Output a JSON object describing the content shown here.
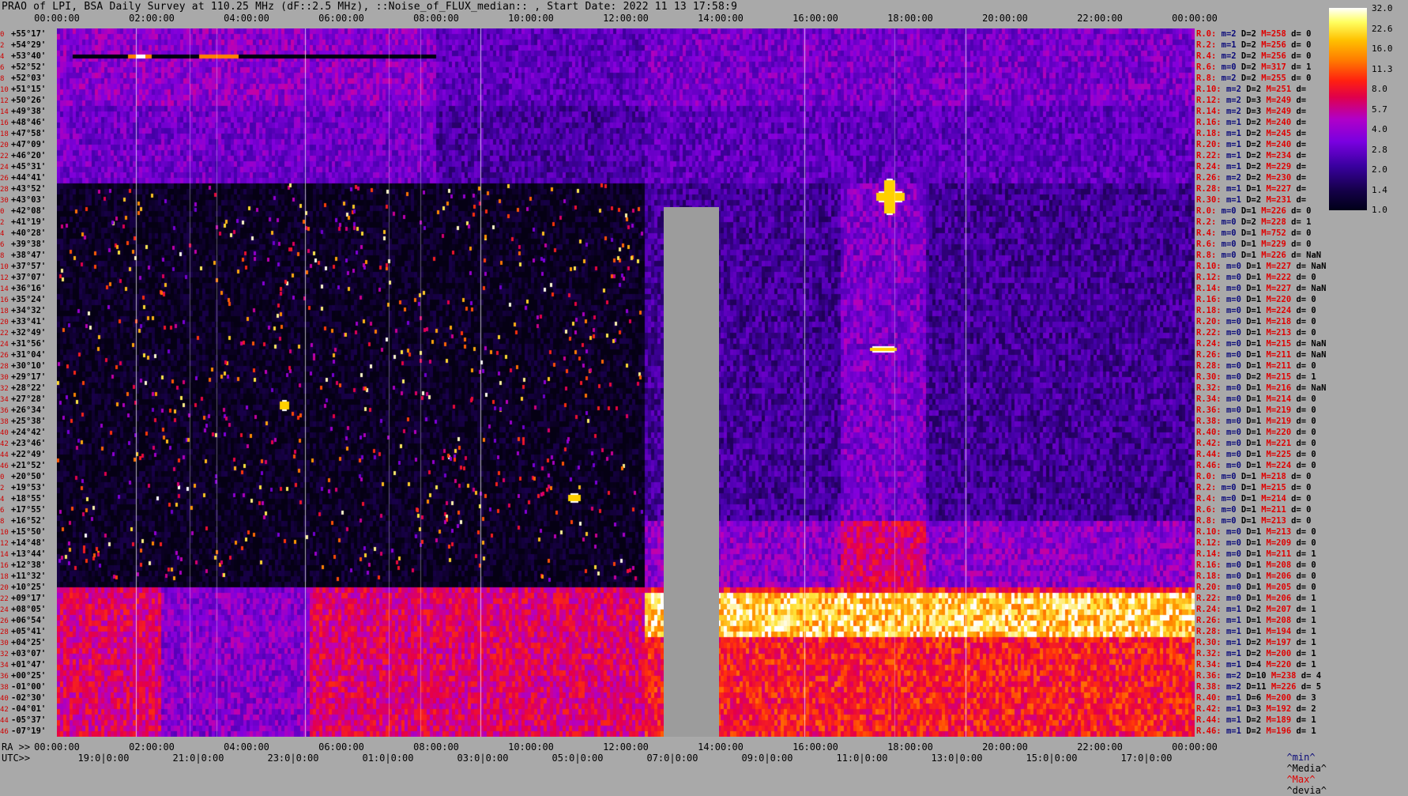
{
  "title": "PRAO of LPI, BSA Daily Survey at 110.25 MHz (dF::2.5 MHz), ::Noise_of_FLUX_median:: , Start Date: 2022 11 13 17:58:9",
  "time_axis_top": [
    "00:00:00",
    "02:00:00",
    "04:00:00",
    "06:00:00",
    "08:00:00",
    "10:00:00",
    "12:00:00",
    "14:00:00",
    "16:00:00",
    "18:00:00",
    "20:00:00",
    "22:00:00",
    "00:00:00"
  ],
  "ra_axis_prefix": "RA >>",
  "ra_axis": [
    "00:00:00",
    "02:00:00",
    "04:00:00",
    "06:00:00",
    "08:00:00",
    "10:00:00",
    "12:00:00",
    "14:00:00",
    "16:00:00",
    "18:00:00",
    "20:00:00",
    "22:00:00",
    "00:00:00"
  ],
  "utc_axis_prefix": "UTC>>",
  "utc_axis": [
    "19:0|0:00",
    "21:0|0:00",
    "23:0|0:00",
    "01:0|0:00",
    "03:0|0:00",
    "05:0|0:00",
    "07:0|0:00",
    "09:0|0:00",
    "11:0|0:00",
    "13:0|0:00",
    "15:0|0:00",
    "17:0|0:00"
  ],
  "colorbar": {
    "labels": [
      "32.0",
      "22.6",
      "16.0",
      "11.3",
      "8.0",
      "5.7",
      "4.0",
      "2.8",
      "2.0",
      "1.4",
      "1.0"
    ],
    "colors": {
      "low": "#000018",
      "mid": "#7a00e0",
      "high": "#ff2010",
      "top": "#ffffff"
    }
  },
  "dec_rows": [
    {
      "idx": "0",
      "dec": "+55°17'"
    },
    {
      "idx": "2",
      "dec": "+54°29'"
    },
    {
      "idx": "4",
      "dec": "+53°40'"
    },
    {
      "idx": "6",
      "dec": "+52°52'"
    },
    {
      "idx": "8",
      "dec": "+52°03'"
    },
    {
      "idx": "10",
      "dec": "+51°15'"
    },
    {
      "idx": "12",
      "dec": "+50°26'"
    },
    {
      "idx": "14",
      "dec": "+49°38'"
    },
    {
      "idx": "16",
      "dec": "+48°46'"
    },
    {
      "idx": "18",
      "dec": "+47°58'"
    },
    {
      "idx": "20",
      "dec": "+47°09'"
    },
    {
      "idx": "22",
      "dec": "+46°20'"
    },
    {
      "idx": "24",
      "dec": "+45°31'"
    },
    {
      "idx": "26",
      "dec": "+44°41'"
    },
    {
      "idx": "28",
      "dec": "+43°52'"
    },
    {
      "idx": "30",
      "dec": "+43°03'"
    },
    {
      "idx": "0",
      "dec": "+42°08'"
    },
    {
      "idx": "2",
      "dec": "+41°19'"
    },
    {
      "idx": "4",
      "dec": "+40°28'"
    },
    {
      "idx": "6",
      "dec": "+39°38'"
    },
    {
      "idx": "8",
      "dec": "+38°47'"
    },
    {
      "idx": "10",
      "dec": "+37°57'"
    },
    {
      "idx": "12",
      "dec": "+37°07'"
    },
    {
      "idx": "14",
      "dec": "+36°16'"
    },
    {
      "idx": "16",
      "dec": "+35°24'"
    },
    {
      "idx": "18",
      "dec": "+34°32'"
    },
    {
      "idx": "20",
      "dec": "+33°41'"
    },
    {
      "idx": "22",
      "dec": "+32°49'"
    },
    {
      "idx": "24",
      "dec": "+31°56'"
    },
    {
      "idx": "26",
      "dec": "+31°04'"
    },
    {
      "idx": "28",
      "dec": "+30°10'"
    },
    {
      "idx": "30",
      "dec": "+29°17'"
    },
    {
      "idx": "32",
      "dec": "+28°22'"
    },
    {
      "idx": "34",
      "dec": "+27°28'"
    },
    {
      "idx": "36",
      "dec": "+26°34'"
    },
    {
      "idx": "38",
      "dec": "+25°38'"
    },
    {
      "idx": "40",
      "dec": "+24°42'"
    },
    {
      "idx": "42",
      "dec": "+23°46'"
    },
    {
      "idx": "44",
      "dec": "+22°49'"
    },
    {
      "idx": "46",
      "dec": "+21°52'"
    },
    {
      "idx": "0",
      "dec": "+20°50'"
    },
    {
      "idx": "2",
      "dec": "+19°53'"
    },
    {
      "idx": "4",
      "dec": "+18°55'"
    },
    {
      "idx": "6",
      "dec": "+17°55'"
    },
    {
      "idx": "8",
      "dec": "+16°52'"
    },
    {
      "idx": "10",
      "dec": "+15°50'"
    },
    {
      "idx": "12",
      "dec": "+14°48'"
    },
    {
      "idx": "14",
      "dec": "+13°44'"
    },
    {
      "idx": "16",
      "dec": "+12°38'"
    },
    {
      "idx": "18",
      "dec": "+11°32'"
    },
    {
      "idx": "20",
      "dec": "+10°25'"
    },
    {
      "idx": "22",
      "dec": "+09°17'"
    },
    {
      "idx": "24",
      "dec": "+08°05'"
    },
    {
      "idx": "26",
      "dec": "+06°54'"
    },
    {
      "idx": "28",
      "dec": "+05°41'"
    },
    {
      "idx": "30",
      "dec": "+04°25'"
    },
    {
      "idx": "32",
      "dec": "+03°07'"
    },
    {
      "idx": "34",
      "dec": "+01°47'"
    },
    {
      "idx": "36",
      "dec": "+00°25'"
    },
    {
      "idx": "38",
      "dec": "-01°00'"
    },
    {
      "idx": "40",
      "dec": "-02°30'"
    },
    {
      "idx": "42",
      "dec": "-04°01'"
    },
    {
      "idx": "44",
      "dec": "-05°37'"
    },
    {
      "idx": "46",
      "dec": "-07°19'"
    }
  ],
  "stat_rows": [
    {
      "r": "R.0:",
      "m": "m=2",
      "d": "D=2",
      "M": "M=258",
      "e": "d= 0"
    },
    {
      "r": "R.2:",
      "m": "m=1",
      "d": "D=2",
      "M": "M=256",
      "e": "d= 0"
    },
    {
      "r": "R.4:",
      "m": "m=2",
      "d": "D=2",
      "M": "M=256",
      "e": "d= 0"
    },
    {
      "r": "R.6:",
      "m": "m=0",
      "d": "D=2",
      "M": "M=317",
      "e": "d= 1"
    },
    {
      "r": "R.8:",
      "m": "m=2",
      "d": "D=2",
      "M": "M=255",
      "e": "d= 0"
    },
    {
      "r": "R.10:",
      "m": "m=2",
      "d": "D=2",
      "M": "M=251",
      "e": "d="
    },
    {
      "r": "R.12:",
      "m": "m=2",
      "d": "D=3",
      "M": "M=249",
      "e": "d="
    },
    {
      "r": "R.14:",
      "m": "m=2",
      "d": "D=3",
      "M": "M=249",
      "e": "d="
    },
    {
      "r": "R.16:",
      "m": "m=1",
      "d": "D=2",
      "M": "M=240",
      "e": "d="
    },
    {
      "r": "R.18:",
      "m": "m=1",
      "d": "D=2",
      "M": "M=245",
      "e": "d="
    },
    {
      "r": "R.20:",
      "m": "m=1",
      "d": "D=2",
      "M": "M=240",
      "e": "d="
    },
    {
      "r": "R.22:",
      "m": "m=1",
      "d": "D=2",
      "M": "M=234",
      "e": "d="
    },
    {
      "r": "R.24:",
      "m": "m=1",
      "d": "D=2",
      "M": "M=229",
      "e": "d="
    },
    {
      "r": "R.26:",
      "m": "m=2",
      "d": "D=2",
      "M": "M=230",
      "e": "d="
    },
    {
      "r": "R.28:",
      "m": "m=1",
      "d": "D=1",
      "M": "M=227",
      "e": "d="
    },
    {
      "r": "R.30:",
      "m": "m=1",
      "d": "D=2",
      "M": "M=231",
      "e": "d="
    },
    {
      "r": "R.0:",
      "m": "m=0",
      "d": "D=1",
      "M": "M=226",
      "e": "d= 0"
    },
    {
      "r": "R.2:",
      "m": "m=0",
      "d": "D=2",
      "M": "M=228",
      "e": "d= 1"
    },
    {
      "r": "R.4:",
      "m": "m=0",
      "d": "D=1",
      "M": "M=752",
      "e": "d= 0"
    },
    {
      "r": "R.6:",
      "m": "m=0",
      "d": "D=1",
      "M": "M=229",
      "e": "d= 0"
    },
    {
      "r": "R.8:",
      "m": "m=0",
      "d": "D=1",
      "M": "M=226",
      "e": "d= NaN"
    },
    {
      "r": "R.10:",
      "m": "m=0",
      "d": "D=1",
      "M": "M=227",
      "e": "d= NaN"
    },
    {
      "r": "R.12:",
      "m": "m=0",
      "d": "D=1",
      "M": "M=222",
      "e": "d= 0"
    },
    {
      "r": "R.14:",
      "m": "m=0",
      "d": "D=1",
      "M": "M=227",
      "e": "d= NaN"
    },
    {
      "r": "R.16:",
      "m": "m=0",
      "d": "D=1",
      "M": "M=220",
      "e": "d= 0"
    },
    {
      "r": "R.18:",
      "m": "m=0",
      "d": "D=1",
      "M": "M=224",
      "e": "d= 0"
    },
    {
      "r": "R.20:",
      "m": "m=0",
      "d": "D=1",
      "M": "M=218",
      "e": "d= 0"
    },
    {
      "r": "R.22:",
      "m": "m=0",
      "d": "D=1",
      "M": "M=213",
      "e": "d= 0"
    },
    {
      "r": "R.24:",
      "m": "m=0",
      "d": "D=1",
      "M": "M=215",
      "e": "d= NaN"
    },
    {
      "r": "R.26:",
      "m": "m=0",
      "d": "D=1",
      "M": "M=211",
      "e": "d= NaN"
    },
    {
      "r": "R.28:",
      "m": "m=0",
      "d": "D=1",
      "M": "M=211",
      "e": "d= 0"
    },
    {
      "r": "R.30:",
      "m": "m=0",
      "d": "D=2",
      "M": "M=215",
      "e": "d= 1"
    },
    {
      "r": "R.32:",
      "m": "m=0",
      "d": "D=1",
      "M": "M=216",
      "e": "d= NaN"
    },
    {
      "r": "R.34:",
      "m": "m=0",
      "d": "D=1",
      "M": "M=214",
      "e": "d= 0"
    },
    {
      "r": "R.36:",
      "m": "m=0",
      "d": "D=1",
      "M": "M=219",
      "e": "d= 0"
    },
    {
      "r": "R.38:",
      "m": "m=0",
      "d": "D=1",
      "M": "M=219",
      "e": "d= 0"
    },
    {
      "r": "R.40:",
      "m": "m=0",
      "d": "D=1",
      "M": "M=220",
      "e": "d= 0"
    },
    {
      "r": "R.42:",
      "m": "m=0",
      "d": "D=1",
      "M": "M=221",
      "e": "d= 0"
    },
    {
      "r": "R.44:",
      "m": "m=0",
      "d": "D=1",
      "M": "M=225",
      "e": "d= 0"
    },
    {
      "r": "R.46:",
      "m": "m=0",
      "d": "D=1",
      "M": "M=224",
      "e": "d= 0"
    },
    {
      "r": "R.0:",
      "m": "m=0",
      "d": "D=1",
      "M": "M=218",
      "e": "d= 0"
    },
    {
      "r": "R.2:",
      "m": "m=0",
      "d": "D=1",
      "M": "M=215",
      "e": "d= 0"
    },
    {
      "r": "R.4:",
      "m": "m=0",
      "d": "D=1",
      "M": "M=214",
      "e": "d= 0"
    },
    {
      "r": "R.6:",
      "m": "m=0",
      "d": "D=1",
      "M": "M=211",
      "e": "d= 0"
    },
    {
      "r": "R.8:",
      "m": "m=0",
      "d": "D=1",
      "M": "M=213",
      "e": "d= 0"
    },
    {
      "r": "R.10:",
      "m": "m=0",
      "d": "D=1",
      "M": "M=213",
      "e": "d= 0"
    },
    {
      "r": "R.12:",
      "m": "m=0",
      "d": "D=1",
      "M": "M=209",
      "e": "d= 0"
    },
    {
      "r": "R.14:",
      "m": "m=0",
      "d": "D=1",
      "M": "M=211",
      "e": "d= 1"
    },
    {
      "r": "R.16:",
      "m": "m=0",
      "d": "D=1",
      "M": "M=208",
      "e": "d= 0"
    },
    {
      "r": "R.18:",
      "m": "m=0",
      "d": "D=1",
      "M": "M=206",
      "e": "d= 0"
    },
    {
      "r": "R.20:",
      "m": "m=0",
      "d": "D=1",
      "M": "M=205",
      "e": "d= 0"
    },
    {
      "r": "R.22:",
      "m": "m=0",
      "d": "D=1",
      "M": "M=206",
      "e": "d= 1"
    },
    {
      "r": "R.24:",
      "m": "m=1",
      "d": "D=2",
      "M": "M=207",
      "e": "d= 1"
    },
    {
      "r": "R.26:",
      "m": "m=1",
      "d": "D=1",
      "M": "M=208",
      "e": "d= 1"
    },
    {
      "r": "R.28:",
      "m": "m=1",
      "d": "D=1",
      "M": "M=194",
      "e": "d= 1"
    },
    {
      "r": "R.30:",
      "m": "m=1",
      "d": "D=2",
      "M": "M=197",
      "e": "d= 1"
    },
    {
      "r": "R.32:",
      "m": "m=1",
      "d": "D=2",
      "M": "M=200",
      "e": "d= 1"
    },
    {
      "r": "R.34:",
      "m": "m=1",
      "d": "D=4",
      "M": "M=220",
      "e": "d= 1"
    },
    {
      "r": "R.36:",
      "m": "m=2",
      "d": "D=10",
      "M": "M=238",
      "e": "d= 4"
    },
    {
      "r": "R.38:",
      "m": "m=2",
      "d": "D=11",
      "M": "M=226",
      "e": "d= 5"
    },
    {
      "r": "R.40:",
      "m": "m=1",
      "d": "D=6",
      "M": "M=200",
      "e": "d= 3"
    },
    {
      "r": "R.42:",
      "m": "m=1",
      "d": "D=3",
      "M": "M=192",
      "e": "d= 2"
    },
    {
      "r": "R.44:",
      "m": "m=1",
      "d": "D=2",
      "M": "M=189",
      "e": "d= 1"
    },
    {
      "r": "R.46:",
      "m": "m=1",
      "d": "D=2",
      "M": "M=196",
      "e": "d= 1"
    }
  ],
  "legend": {
    "min": "^min^",
    "median": "^Media^",
    "max": "^Max^",
    "devia": "^devia^"
  }
}
